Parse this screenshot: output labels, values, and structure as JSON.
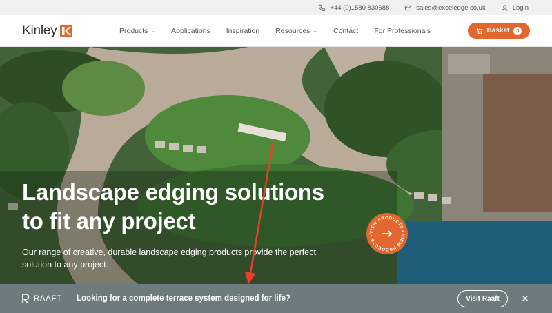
{
  "topbar": {
    "phone": "+44 (0)1580 830688",
    "email": "sales@exceledge.co.uk",
    "login": "Login"
  },
  "nav": {
    "logo_text": "Kinley",
    "items": [
      {
        "label": "Products",
        "dropdown": true
      },
      {
        "label": "Applications",
        "dropdown": false
      },
      {
        "label": "Inspiration",
        "dropdown": false
      },
      {
        "label": "Resources",
        "dropdown": true
      },
      {
        "label": "Contact",
        "dropdown": false
      },
      {
        "label": "For Professionals",
        "dropdown": false
      }
    ],
    "basket_label": "Basket",
    "basket_count": "0"
  },
  "hero": {
    "title_line1": "Landscape edging solutions",
    "title_line2": "to fit any project",
    "subtitle_line1": "Our range of creative, durable landscape edging products provide the perfect",
    "subtitle_line2": "solution to any project.",
    "badge_text": "VIEW PRODUCTS • VIEW PRODUCTS •"
  },
  "banner": {
    "logo_text": "RAAFT",
    "message": "Looking for a complete terrace system designed for life?",
    "button_label": "Visit Raaft",
    "close_symbol": "✕"
  },
  "colors": {
    "accent": "#e2672e",
    "banner_bg": "#6d7a7e",
    "teal": "#1f5d78",
    "annotation": "#e8402a"
  }
}
